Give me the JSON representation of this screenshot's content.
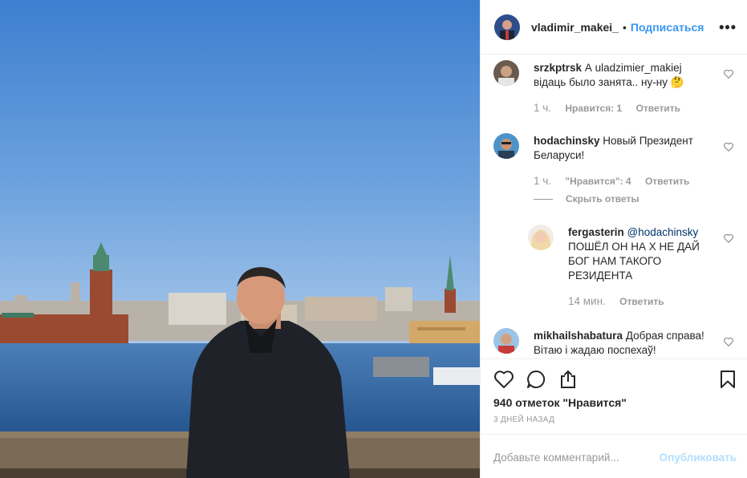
{
  "post": {
    "author": "vladimir_makei_",
    "separator": "•",
    "follow_label": "Подписаться",
    "more_label": "•••"
  },
  "comments": [
    {
      "user": "srzkptrsk",
      "text": "А uladzimier_makiej відаць было занята.. ну-ну 🤔",
      "time": "1 ч.",
      "likes": "Нравится: 1",
      "reply": "Ответить"
    },
    {
      "user": "hodachinsky",
      "text": "Новый Президент Беларуси!",
      "time": "1 ч.",
      "likes": "\"Нравится\": 4",
      "reply": "Ответить",
      "hide_replies": "Скрыть ответы"
    },
    {
      "user": "fergasterin",
      "mention": "@hodachinsky",
      "text": "ПОШЁЛ ОН НА Х НЕ ДАЙ БОГ НАМ ТАКОГО РЕЗИДЕНТА",
      "time": "14 мин.",
      "reply": "Ответить"
    },
    {
      "user": "mikhailshabatura",
      "text": "Добрая справа! Вітаю і жадаю поспехаў!"
    }
  ],
  "actions": {
    "likes_text": "940 отметок \"Нравится\"",
    "date": "3 ДНЕЙ НАЗАД"
  },
  "add_comment": {
    "placeholder": "Добавьте комментарий...",
    "post_label": "Опубликовать"
  },
  "colors": {
    "accent": "#3897f0",
    "post_disabled": "#b2dffc",
    "sky": "#4f8fd8",
    "water": "#2f5f9a"
  }
}
